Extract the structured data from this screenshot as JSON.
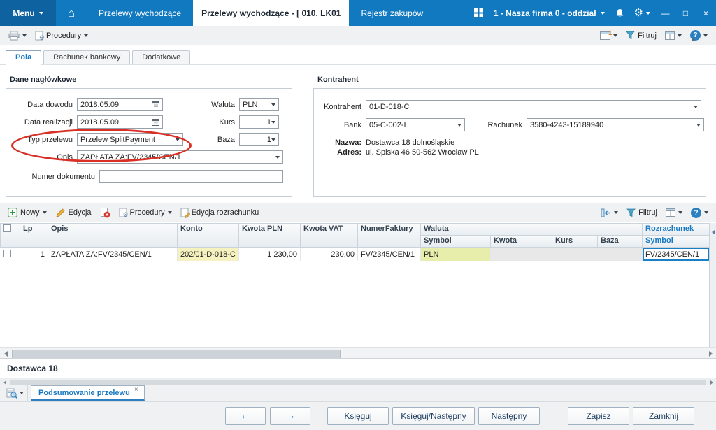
{
  "titlebar": {
    "menu_label": "Menu",
    "tabs": [
      {
        "label": "Przelewy wychodzące"
      },
      {
        "label": "Przelewy wychodzące - [ 010, LK01"
      },
      {
        "label": "Rejestr zakupów"
      }
    ],
    "company_label": "1 - Nasza firma 0 - oddział"
  },
  "ribbon": {
    "procedury_label": "Procedury",
    "filtruj_label": "Filtruj"
  },
  "form_tabs": {
    "pola": "Pola",
    "rachunek_bankowy": "Rachunek bankowy",
    "dodatkowe": "Dodatkowe"
  },
  "naglowek": {
    "title": "Dane nagłówkowe",
    "data_dowodu_label": "Data dowodu",
    "data_dowodu_value": "2018.05.09",
    "data_realizacji_label": "Data realizacji",
    "data_realizacji_value": "2018.05.09",
    "typ_przelewu_label": "Typ przelewu",
    "typ_przelewu_value": "Przelew SplitPayment",
    "opis_label": "Opis",
    "opis_value": "ZAPŁATA ZA:FV/2345/CEN/1",
    "numer_dokumentu_label": "Numer dokumentu",
    "numer_dokumentu_value": "",
    "waluta_label": "Waluta",
    "waluta_value": "PLN",
    "kurs_label": "Kurs",
    "kurs_value": "1",
    "baza_label": "Baza",
    "baza_value": "1"
  },
  "kontrahent": {
    "title": "Kontrahent",
    "kontrahent_label": "Kontrahent",
    "kontrahent_value": "01-D-018-C",
    "bank_label": "Bank",
    "bank_value": "05-C-002-I",
    "rachunek_label": "Rachunek",
    "rachunek_value": "3580-4243-15189940",
    "nazwa_label": "Nazwa:",
    "nazwa_value": "Dostawca 18 dolnośląskie",
    "adres_label": "Adres:",
    "adres_value": "ul. Spiska 46 50-562 Wrocław PL"
  },
  "grid_toolbar": {
    "nowy_label": "Nowy",
    "edycja_label": "Edycja",
    "procedury_label": "Procedury",
    "edycja_rozrachunku_label": "Edycja rozrachunku",
    "filtruj_label": "Filtruj"
  },
  "table": {
    "columns": {
      "lp": "Lp",
      "opis": "Opis",
      "konto": "Konto",
      "kwota_pln": "Kwota PLN",
      "kwota_vat": "Kwota VAT",
      "numer_faktury": "NumerFaktury",
      "waluta": "Waluta",
      "waluta_symbol": "Symbol",
      "waluta_kwota": "Kwota",
      "waluta_kurs": "Kurs",
      "waluta_baza": "Baza",
      "rozrachunek": "Rozrachunek",
      "rozrachunek_symbol": "Symbol"
    },
    "rows": [
      {
        "lp": "1",
        "opis": "ZAPŁATA ZA:FV/2345/CEN/1",
        "konto": "202/01-D-018-C",
        "kwota_pln": "1 230,00",
        "kwota_vat": "230,00",
        "numer_faktury": "FV/2345/CEN/1",
        "waluta_symbol": "PLN",
        "waluta_kwota": "",
        "waluta_kurs": "",
        "waluta_baza": "",
        "rozrachunek_symbol": "FV/2345/CEN/1"
      }
    ],
    "group_footer": "Dostawca 18"
  },
  "bottom_panel": {
    "tab_label": "Podsumowanie przelewu"
  },
  "footer": {
    "ksieguj_label": "Księguj",
    "ksieguj_nastepny_label": "Księguj/Następny",
    "nastepny_label": "Następny",
    "zapisz_label": "Zapisz",
    "zamknij_label": "Zamknij"
  },
  "colors": {
    "titlebar_blue": "#1179c0",
    "accent_blue": "#1779c4",
    "highlight_yellow": "#f6f2bf",
    "highlight_green": "#e7edaa",
    "disabled_gray": "#e8e8e8",
    "annotation_red": "#d93025"
  }
}
